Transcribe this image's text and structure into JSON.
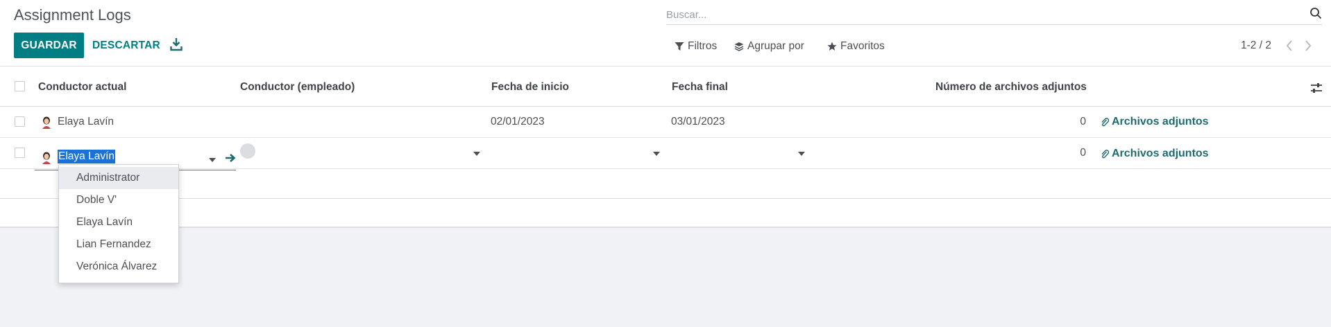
{
  "header": {
    "title": "Assignment Logs",
    "save_label": "GUARDAR",
    "discard_label": "DESCARTAR"
  },
  "search": {
    "placeholder": "Buscar..."
  },
  "filters": {
    "filter_label": "Filtros",
    "group_label": "Agrupar por",
    "favorites_label": "Favoritos"
  },
  "pager": {
    "text": "1-2 / 2"
  },
  "table": {
    "columns": [
      "Conductor actual",
      "Conductor (empleado)",
      "Fecha de inicio",
      "Fecha final",
      "Número de archivos adjuntos"
    ],
    "rows": [
      {
        "driver": "Elaya Lavín",
        "employee": "",
        "start": "02/01/2023",
        "end": "03/01/2023",
        "attachments": "0",
        "attach_label": "Archivos adjuntos"
      },
      {
        "driver": "Elaya Lavín",
        "employee": "",
        "start": "",
        "end": "",
        "attachments": "0",
        "attach_label": "Archivos adjuntos"
      }
    ]
  },
  "dropdown": {
    "options": [
      "Administrator",
      "Doble V'",
      "Elaya Lavín",
      "Lian Fernandez",
      "Verónica Álvarez"
    ],
    "highlighted_index": 0
  },
  "colors": {
    "primary": "#017e84",
    "link": "#1f6b6f",
    "selection": "#1a72d9",
    "background": "#f1f2f6"
  }
}
